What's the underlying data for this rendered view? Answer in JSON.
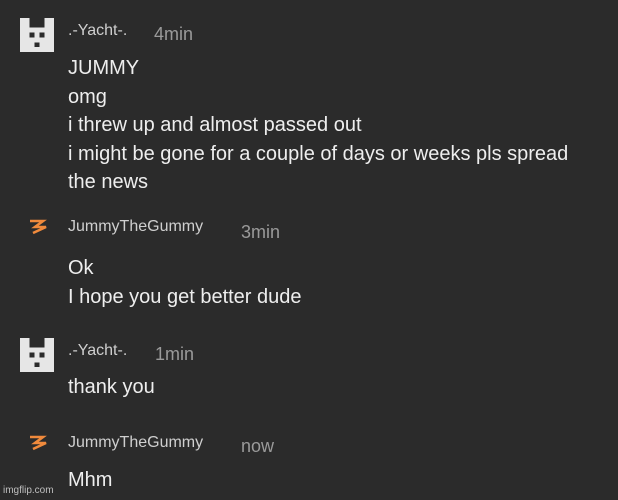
{
  "messages": [
    {
      "author": ".-Yacht-.",
      "time": "4min",
      "lines": [
        "JUMMY",
        "omg",
        "i threw up and almost passed out",
        "i might be gone for a couple of days or weeks pls spread",
        "the news"
      ],
      "avatar_icon": "pixel-cat-icon"
    },
    {
      "author": "JummyTheGummy",
      "time": "3min",
      "lines": [
        "Ok",
        "I hope you get better dude"
      ],
      "avatar_icon": "orange-bolt-icon"
    },
    {
      "author": ".-Yacht-.",
      "time": "1min",
      "lines": [
        "thank you"
      ],
      "avatar_icon": "pixel-cat-icon"
    },
    {
      "author": "JummyTheGummy",
      "time": "now",
      "lines": [
        "Mhm"
      ],
      "avatar_icon": "orange-bolt-icon"
    }
  ],
  "watermark": "imgflip.com",
  "colors": {
    "background": "#2b2b2b",
    "text": "#eeeeee",
    "name": "#cfcfcf",
    "timestamp": "#9a9a9a",
    "bolt": "#f08a3c"
  }
}
